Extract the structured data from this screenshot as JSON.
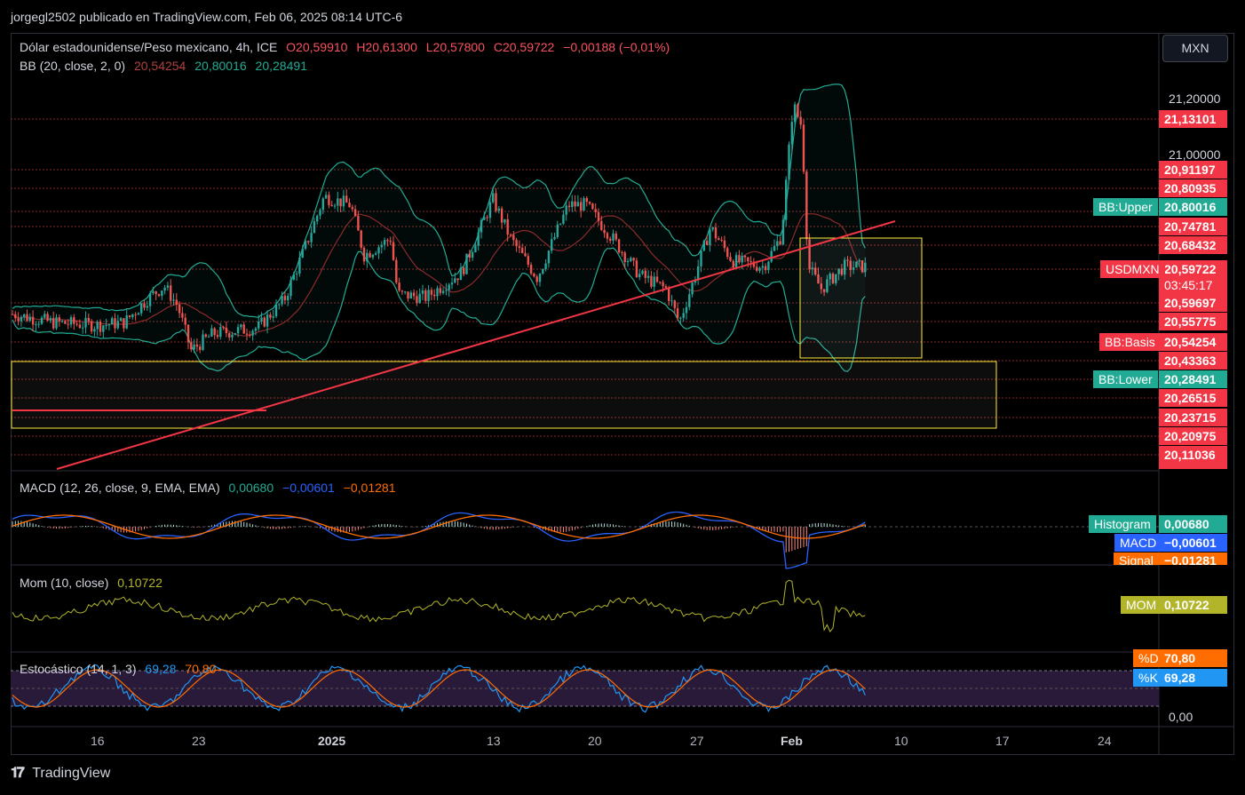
{
  "header": {
    "published": "jorgegl2502 publicado en TradingView.com, Feb 06, 2025 08:14 UTC-6"
  },
  "symbol": {
    "name": "Dólar estadounidense/Peso mexicano, 4h, ICE",
    "open": "O20,59910",
    "high": "H20,61300",
    "low": "L20,57800",
    "close": "C20,59722",
    "change": "−0,00188 (−0,01%)"
  },
  "bb": {
    "label": "BB (20, close, 2, 0)",
    "basis": "20,54254",
    "upper": "20,80016",
    "lower": "20,28491"
  },
  "currency_button": "MXN",
  "price_axis": {
    "ticks": [
      "21,20000",
      "21,00000"
    ],
    "levels": [
      "21,13101",
      "20,91197",
      "20,80935",
      "20,74781",
      "20,68432",
      "20,59697",
      "20,55775",
      "20,43363",
      "20,26515",
      "20,23715",
      "20,20975",
      "20,11036"
    ],
    "countdown": "03:45:17"
  },
  "tags": {
    "bb_upper": {
      "label": "BB:Upper",
      "value": "20,80016"
    },
    "usdmxn": {
      "label": "USDMXN",
      "value": "20,59722"
    },
    "bb_basis": {
      "label": "BB:Basis",
      "value": "20,54254"
    },
    "bb_lower": {
      "label": "BB:Lower",
      "value": "20,28491"
    }
  },
  "macd": {
    "label": "MACD (12, 26, close, 9, EMA, EMA)",
    "v1": "0,00680",
    "v2": "−0,00601",
    "v3": "−0,01281",
    "histogram": {
      "label": "Histogram",
      "value": "0,00680"
    },
    "macd_tag": {
      "label": "MACD",
      "value": "−0,00601"
    },
    "signal": {
      "label": "Signal",
      "value": "−0,01281"
    }
  },
  "mom": {
    "label": "Mom (10, close)",
    "value": "0,10722",
    "tag": "MOM",
    "tag_value": "0,10722"
  },
  "stoch": {
    "label": "Estocástico (14, 1, 3)",
    "k": "69,28",
    "d": "70,80",
    "d_tag": "%D",
    "d_value": "70,80",
    "k_tag": "%K",
    "k_value": "69,28",
    "zero": "0,00"
  },
  "x_axis": [
    "16",
    "23",
    "2025",
    "13",
    "20",
    "27",
    "Feb",
    "10",
    "17",
    "24"
  ],
  "footer": "TradingView",
  "colors": {
    "bull": "#26a69a",
    "bear": "#ef5350",
    "label_red": "#f23645",
    "teal": "#22ab94",
    "trend": "#f23645",
    "box": "#ffeb3b",
    "macd": "#2962ff",
    "signal": "#ff6d00",
    "mom": "#b2b52a",
    "stoch_bg": "#2a1a3a"
  }
}
